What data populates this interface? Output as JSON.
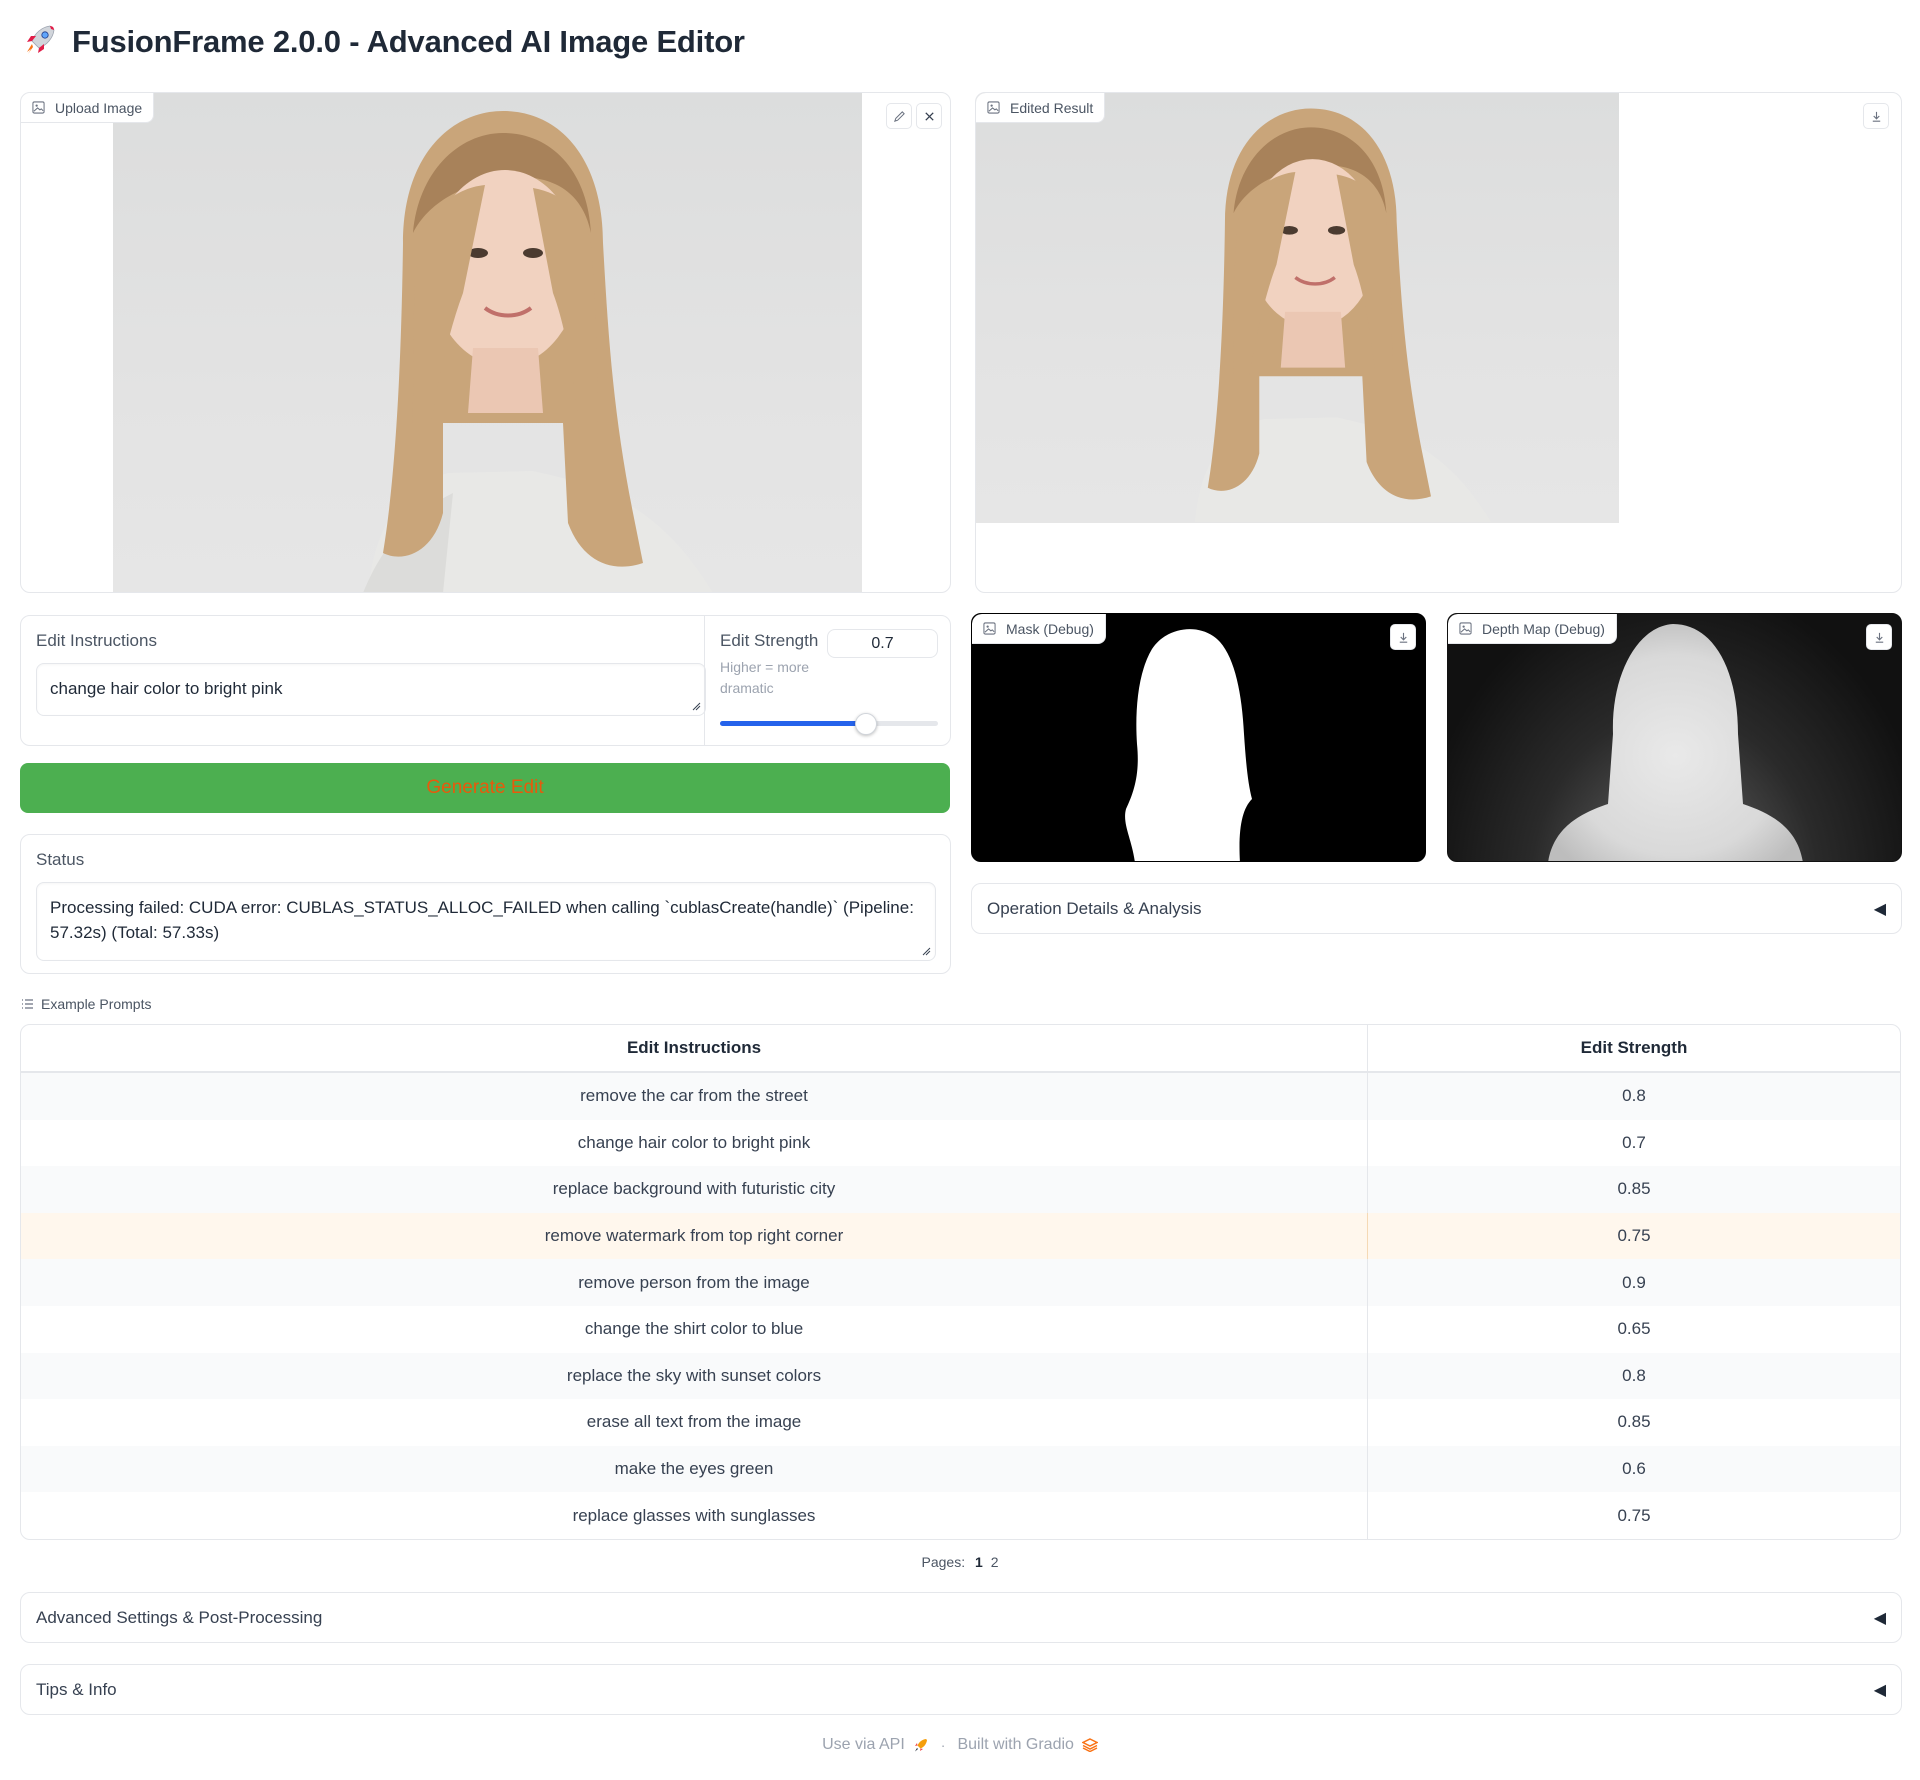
{
  "header": {
    "icon": "rocket-icon",
    "title": "FusionFrame 2.0.0 - Advanced AI Image Editor"
  },
  "upload": {
    "label": "Upload Image"
  },
  "result": {
    "label": "Edited Result"
  },
  "mask": {
    "label": "Mask (Debug)"
  },
  "depth": {
    "label": "Depth Map (Debug)"
  },
  "instructions": {
    "label": "Edit Instructions",
    "value": "change hair color to bright pink"
  },
  "strength": {
    "label": "Edit Strength",
    "hint": "Higher = more dramatic",
    "value": "0.7",
    "min": 0,
    "max": 1,
    "slider_fraction": 0.7
  },
  "generate": {
    "label": "Generate Edit"
  },
  "status": {
    "label": "Status",
    "value": "Processing failed: CUDA error: CUBLAS_STATUS_ALLOC_FAILED when calling `cublasCreate(handle)` (Pipeline: 57.32s) (Total: 57.33s)"
  },
  "operation": {
    "label": "Operation Details & Analysis"
  },
  "examples": {
    "label": "Example Prompts",
    "headers": [
      "Edit Instructions",
      "Edit Strength"
    ],
    "rows": [
      [
        "remove the car from the street",
        "0.8"
      ],
      [
        "change hair color to bright pink",
        "0.7"
      ],
      [
        "replace background with futuristic city",
        "0.85"
      ],
      [
        "remove watermark from top right corner",
        "0.75"
      ],
      [
        "remove person from the image",
        "0.9"
      ],
      [
        "change the shirt color to blue",
        "0.65"
      ],
      [
        "replace the sky with sunset colors",
        "0.8"
      ],
      [
        "erase all text from the image",
        "0.85"
      ],
      [
        "make the eyes green",
        "0.6"
      ],
      [
        "replace glasses with sunglasses",
        "0.75"
      ]
    ],
    "highlighted_row": 3,
    "pages_label": "Pages:",
    "pages": [
      "1",
      "2"
    ]
  },
  "advanced": {
    "label": "Advanced Settings & Post-Processing"
  },
  "tips": {
    "label": "Tips & Info"
  },
  "footer": {
    "api": "Use via API",
    "separator": "·",
    "built": "Built with Gradio"
  },
  "colors": {
    "generate_bg": "#4caf50",
    "generate_text": "#e8590c",
    "slider": "#2563eb",
    "highlight_row": "#fff7ed"
  }
}
